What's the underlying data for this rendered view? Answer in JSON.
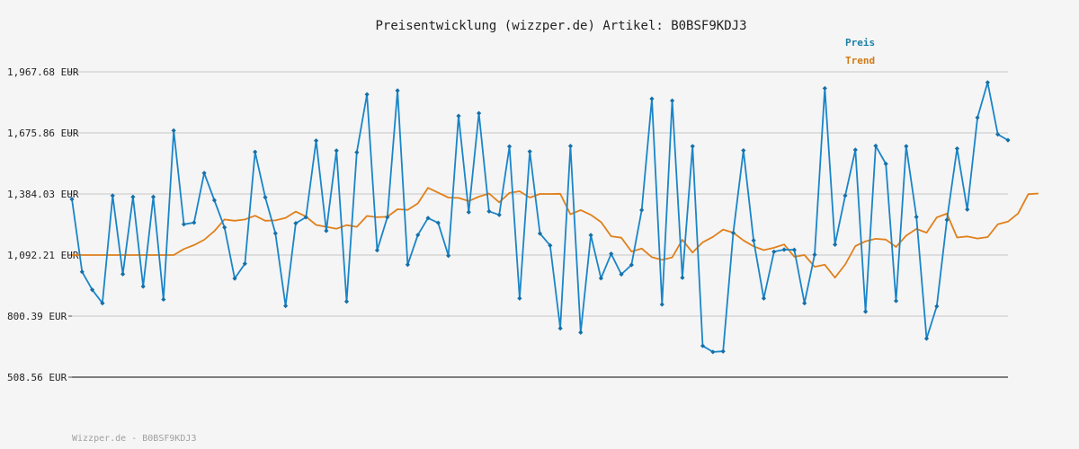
{
  "chart_data": {
    "type": "line",
    "title": "Preisentwicklung (wizzper.de) Artikel: B0BSF9KDJ3",
    "footer": "Wizzper.de - B0BSF9KDJ3",
    "ylim": [
      508.56,
      1967.68
    ],
    "yticks": [
      {
        "value": 508.56,
        "label": "508.56 EUR"
      },
      {
        "value": 800.39,
        "label": "800.39 EUR"
      },
      {
        "value": 1092.21,
        "label": "1,092.21 EUR"
      },
      {
        "value": 1384.03,
        "label": "1,384.03 EUR"
      },
      {
        "value": 1675.86,
        "label": "1,675.86 EUR"
      },
      {
        "value": 1967.68,
        "label": "1,967.68 EUR"
      }
    ],
    "grid": true,
    "legend_position": "top-right",
    "colors": {
      "preis": "#1a85c8",
      "trend": "#e0801c"
    },
    "series": [
      {
        "name": "Preis",
        "values": [
          1359,
          1012,
          926,
          862,
          1376,
          1001,
          1370,
          942,
          1370,
          880,
          1687,
          1239,
          1247,
          1484,
          1354,
          1224,
          980,
          1051,
          1585,
          1368,
          1196,
          849,
          1244,
          1273,
          1639,
          1208,
          1591,
          870,
          1583,
          1860,
          1115,
          1273,
          1878,
          1046,
          1188,
          1269,
          1246,
          1089,
          1757,
          1297,
          1770,
          1301,
          1284,
          1611,
          885,
          1587,
          1195,
          1138,
          742,
          1613,
          722,
          1187,
          981,
          1098,
          1000,
          1045,
          1307,
          1839,
          856,
          1830,
          984,
          1612,
          658,
          629,
          632,
          1198,
          1592,
          1162,
          885,
          1108,
          1118,
          1117,
          862,
          1094,
          1889,
          1142,
          1376,
          1595,
          822,
          1614,
          1528,
          873,
          1612,
          1274,
          693,
          847,
          1260,
          1601,
          1310,
          1749,
          1917,
          1669,
          1641
        ],
        "trend": [
          1092.21,
          1092.21,
          1092.21,
          1092.21,
          1092.21,
          1092.21,
          1092.21,
          1092.21,
          1092.21,
          1092.21,
          1092.21,
          1121,
          1140,
          1165,
          1207,
          1262,
          1256,
          1262,
          1280,
          1256,
          1258,
          1270,
          1300,
          1276,
          1236,
          1227,
          1218,
          1235,
          1227,
          1279,
          1273,
          1275,
          1311,
          1308,
          1339,
          1413,
          1390,
          1367,
          1365,
          1350,
          1371,
          1386,
          1344,
          1389,
          1397,
          1367,
          1384,
          1384,
          1385,
          1287,
          1307,
          1284,
          1250,
          1182,
          1175,
          1109,
          1123,
          1082,
          1069,
          1081,
          1165,
          1104,
          1153,
          1179,
          1214,
          1199,
          1162,
          1134,
          1116,
          1127,
          1143,
          1084,
          1092,
          1036,
          1046,
          984,
          1047,
          1135,
          1158,
          1170,
          1166,
          1131,
          1185,
          1217,
          1199,
          1272,
          1290,
          1176,
          1181,
          1171,
          1178,
          1239,
          1252,
          1291,
          1383,
          1386
        ]
      }
    ]
  },
  "legend": {
    "preis_label": "Preis",
    "trend_label": "Trend"
  }
}
